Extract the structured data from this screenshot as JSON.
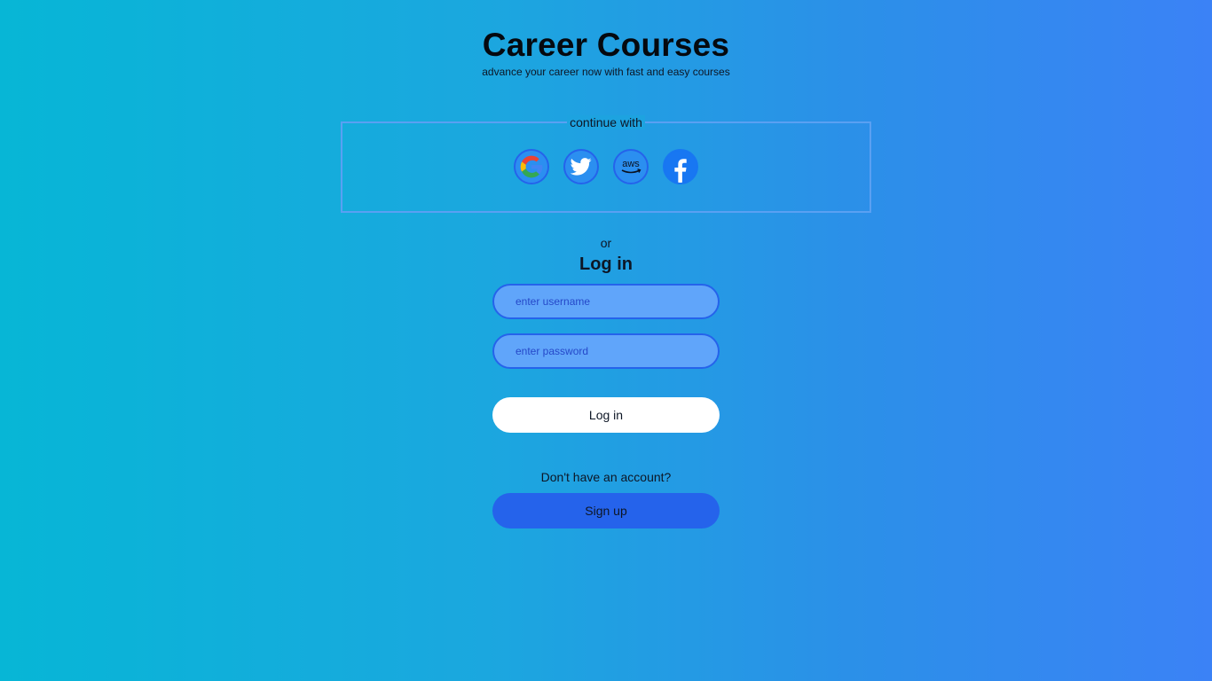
{
  "header": {
    "title": "Career Courses",
    "subtitle": "advance your career now with fast and easy courses"
  },
  "social": {
    "label": "continue with",
    "providers": [
      {
        "name": "Google",
        "icon": "google-icon"
      },
      {
        "name": "Twitter",
        "icon": "twitter-icon"
      },
      {
        "name": "AWS",
        "icon": "aws-icon"
      },
      {
        "name": "Facebook",
        "icon": "facebook-icon"
      }
    ]
  },
  "divider": {
    "text": "or"
  },
  "login": {
    "heading": "Log in",
    "username_placeholder": "enter username",
    "username_value": "",
    "password_placeholder": "enter password",
    "password_value": "",
    "submit_label": "Log in"
  },
  "signup": {
    "prompt": "Don't have an account?",
    "button_label": "Sign up"
  },
  "colors": {
    "gradient_start": "#07b6d6",
    "gradient_end": "#3b82f6",
    "input_bg": "#60a5fa",
    "input_border": "#2563eb",
    "signup_bg": "#2563eb",
    "login_bg": "#ffffff"
  }
}
